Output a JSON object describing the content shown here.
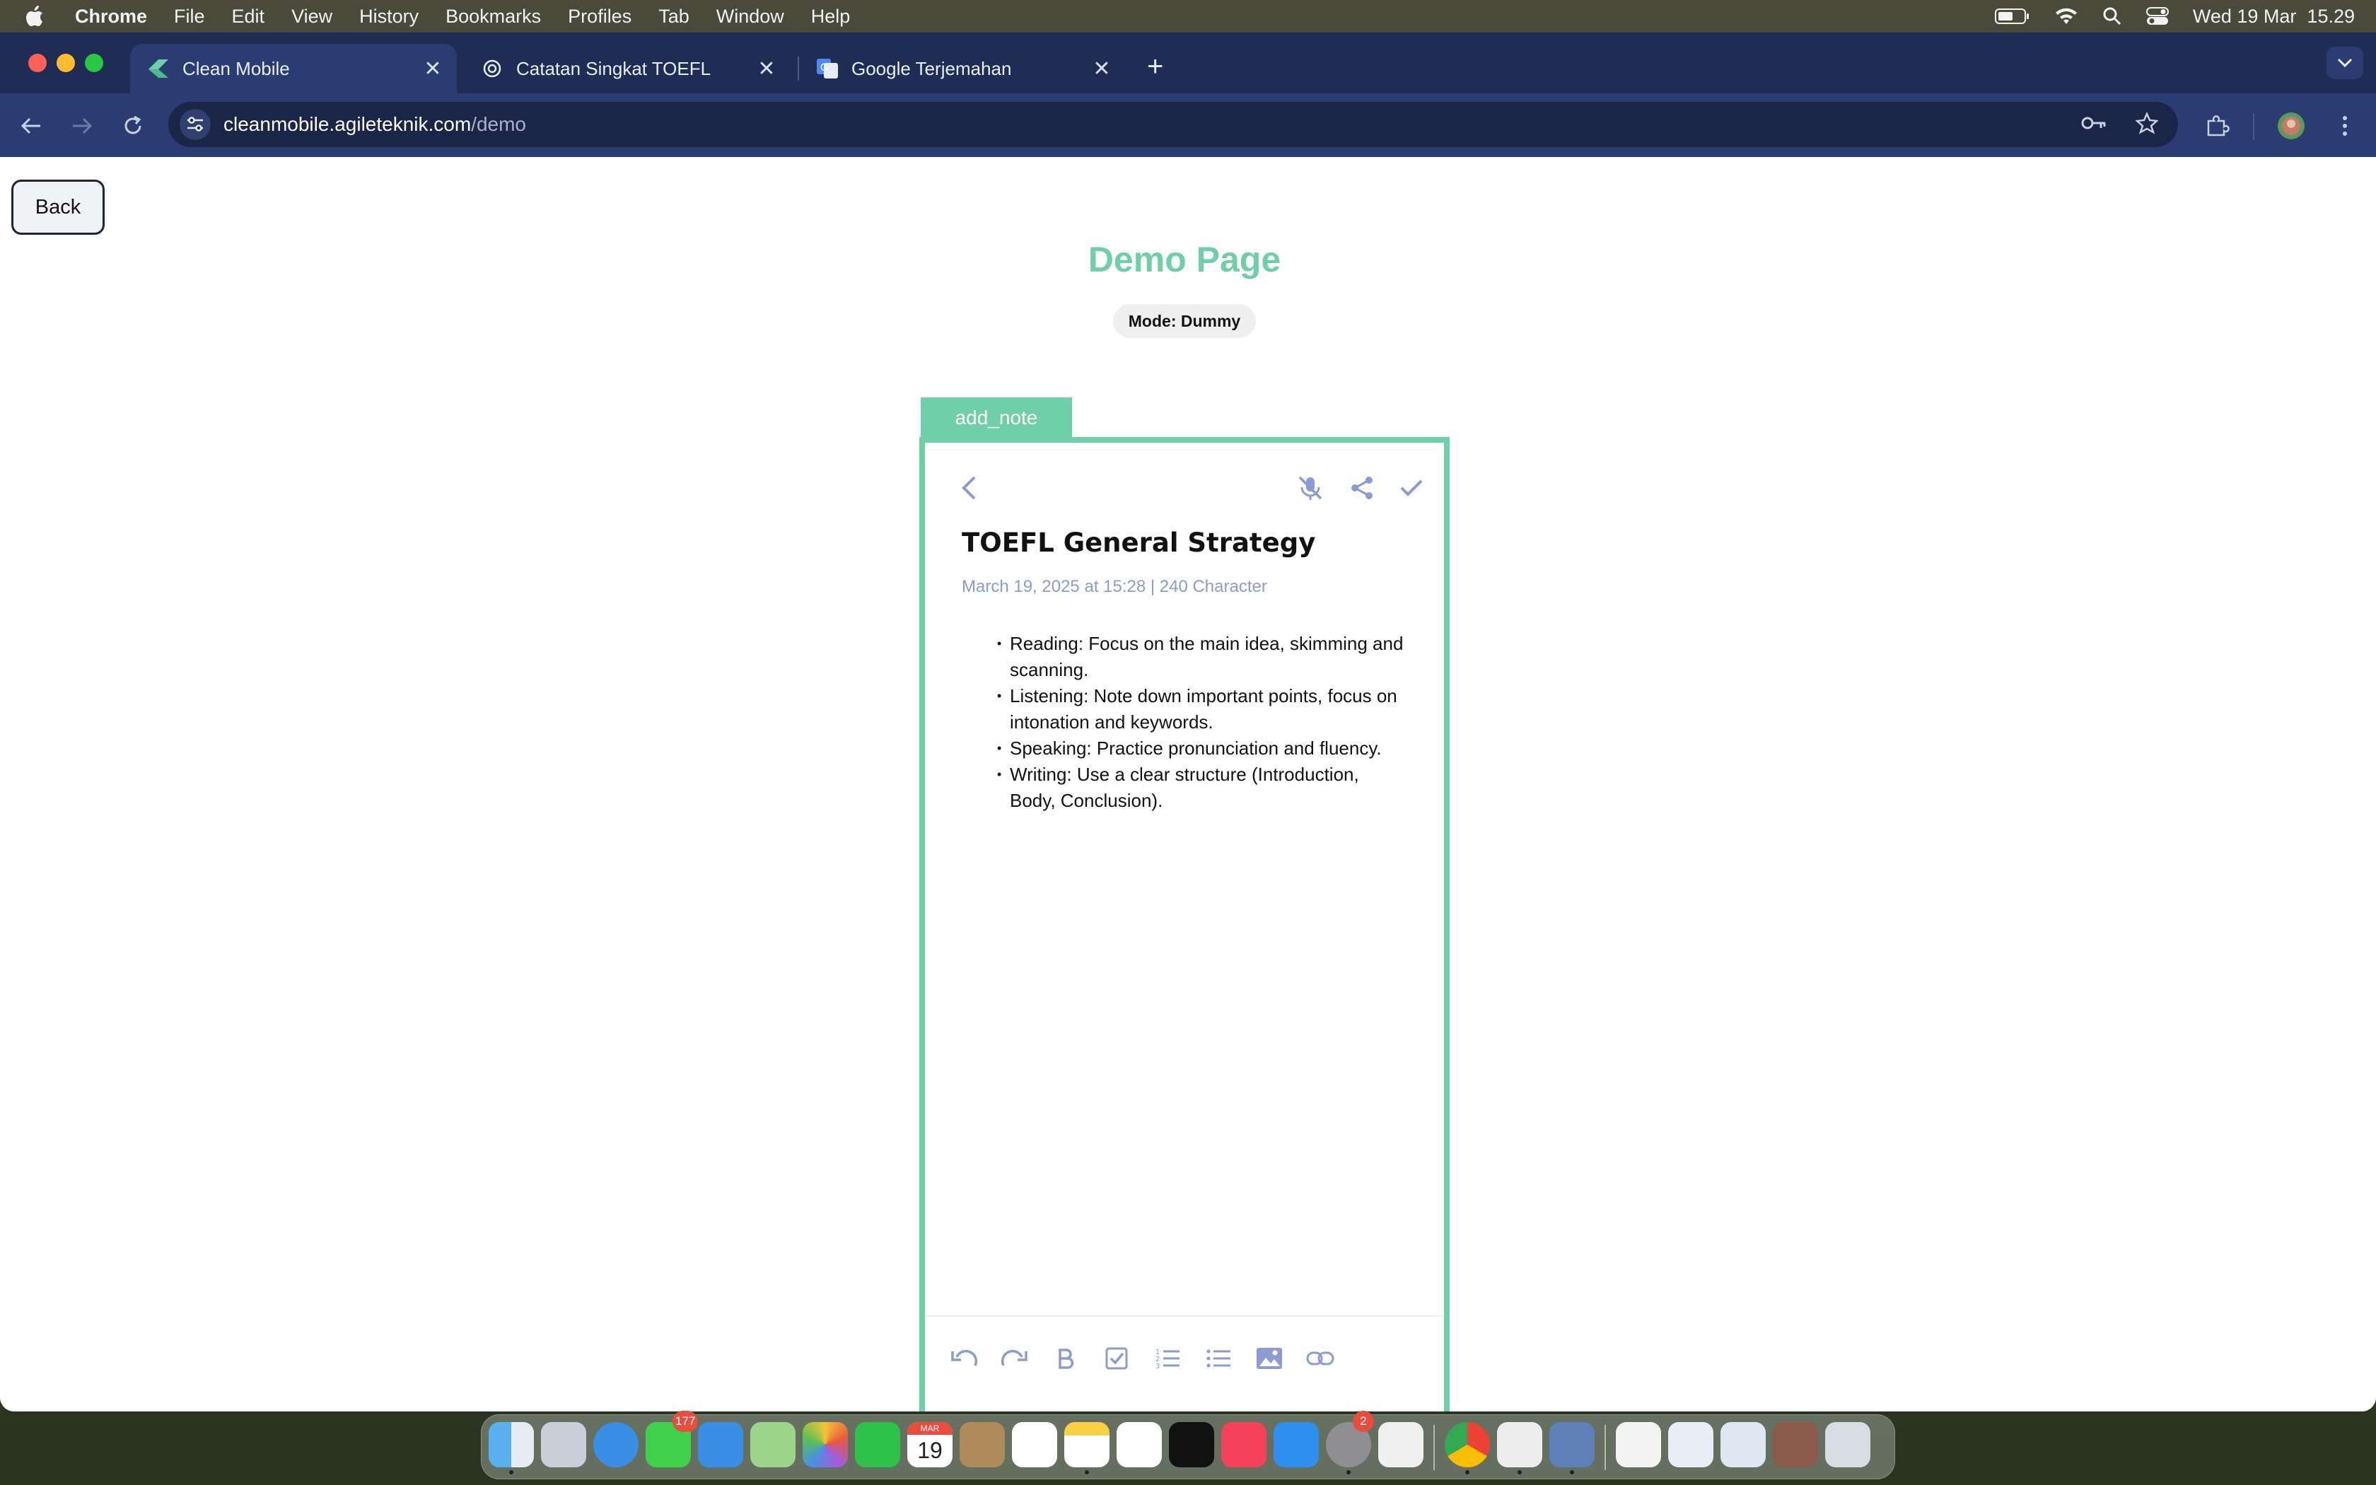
{
  "menubar": {
    "app_name": "Chrome",
    "items": [
      "File",
      "Edit",
      "View",
      "History",
      "Bookmarks",
      "Profiles",
      "Tab",
      "Window",
      "Help"
    ],
    "clock": "Wed 19 Mar  15.29"
  },
  "browser": {
    "tabs": [
      {
        "title": "Clean Mobile",
        "icon": "clean-mobile-logo",
        "active": true
      },
      {
        "title": "Catatan Singkat TOEFL",
        "icon": "chatgpt-logo",
        "active": false
      },
      {
        "title": "Google Terjemahan",
        "icon": "google-translate-logo",
        "active": false
      }
    ],
    "url_host": "cleanmobile.agileteknik.com",
    "url_path": "/demo"
  },
  "page": {
    "back_label": "Back",
    "title": "Demo Page",
    "mode_badge": "Mode: Dummy",
    "frame_tag": "add_note",
    "accent_color": "#6fcfa9"
  },
  "note": {
    "title": "TOEFL General Strategy",
    "meta": "March 19, 2025 at 15:28 | 240 Character",
    "meta_color": "#8a9bd6",
    "bullets": [
      "Reading: Focus on the main idea, skimming and scanning.",
      "Listening: Note down important points, focus on intonation and keywords.",
      "Speaking: Practice pronunciation and fluency.",
      "Writing: Use a clear structure (Introduction, Body, Conclusion)."
    ],
    "toolbar_icons": [
      "undo-icon",
      "redo-icon",
      "bold-icon",
      "checkbox-icon",
      "numbered-list-icon",
      "bullet-list-icon",
      "image-icon",
      "link-icon"
    ]
  },
  "dock": {
    "calendar_month": "MAR",
    "calendar_day": "19",
    "messages_badge": "177",
    "settings_badge": "2"
  }
}
